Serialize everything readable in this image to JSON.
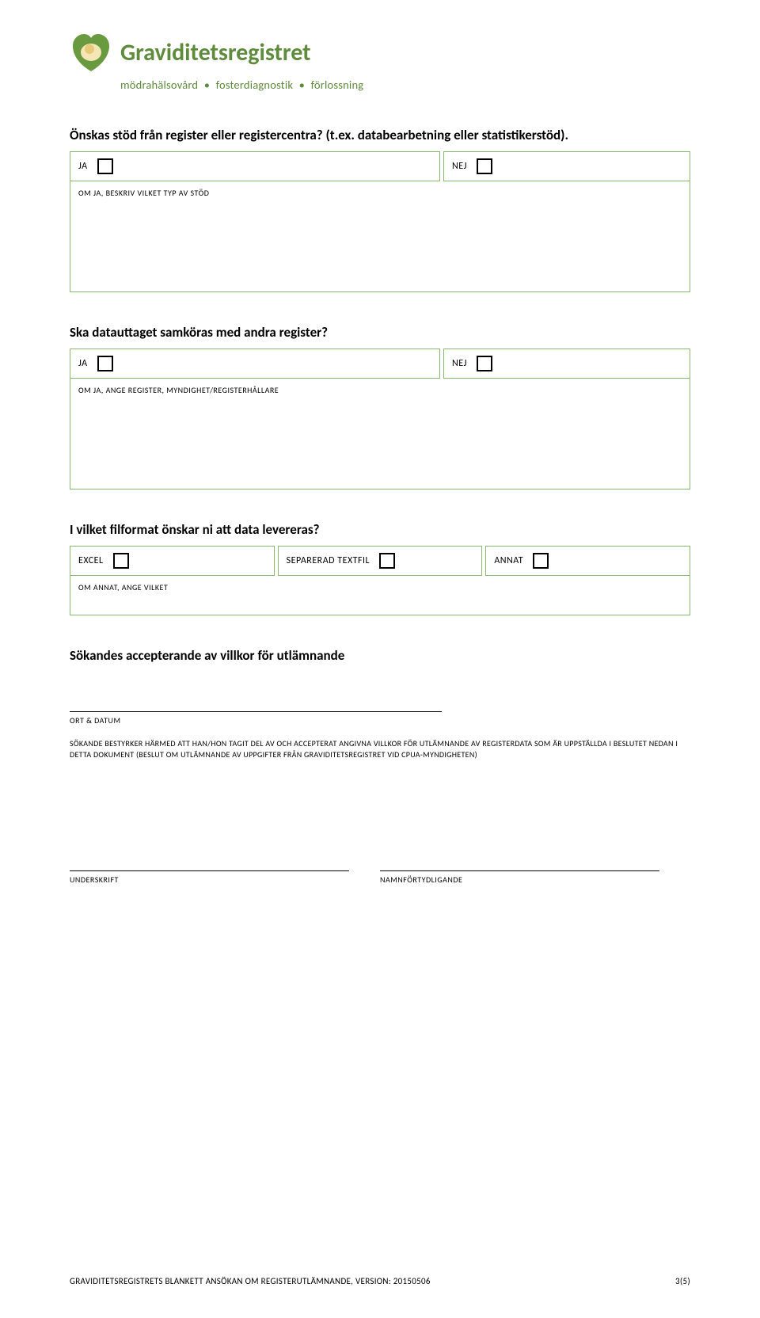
{
  "logo": {
    "title": "Graviditetsregistret",
    "tag1": "mödrahälsovård",
    "tag2": "fosterdiagnostik",
    "tag3": "förlossning"
  },
  "q1": {
    "heading": "Önskas stöd från register eller registercentra? (t.ex. databearbetning eller statistikerstöd).",
    "ja": "JA",
    "nej": "NEJ",
    "sub": "OM JA, BESKRIV VILKET TYP AV STÖD"
  },
  "q2": {
    "heading": "Ska datauttaget samköras med andra register?",
    "ja": "JA",
    "nej": "NEJ",
    "sub": "OM JA, ANGE REGISTER, MYNDIGHET/REGISTERHÅLLARE"
  },
  "q3": {
    "heading": "I vilket filformat önskar ni att data levereras?",
    "opt1": "EXCEL",
    "opt2": "SEPARERAD TEXTFIL",
    "opt3": "ANNAT",
    "sub": "OM ANNAT, ANGE VILKET"
  },
  "accept": {
    "heading": "Sökandes accepterande av villkor för utlämnande",
    "ort_datum": "ORT & DATUM",
    "disclaimer": "SÖKANDE BESTYRKER HÄRMED ATT HAN/HON TAGIT DEL AV OCH ACCEPTERAT ANGIVNA VILLKOR FÖR UTLÄMNANDE AV REGISTERDATA SOM ÄR UPPSTÄLLDA I BESLUTET NEDAN I DETTA DOKUMENT (BESLUT OM UTLÄMNANDE AV UPPGIFTER FRÅN GRAVIDITETSREGISTRET VID CPUA-MYNDIGHETEN)",
    "underskrift": "UNDERSKRIFT",
    "namn": "NAMNFÖRTYDLIGANDE"
  },
  "footer": {
    "left": "GRAVIDITETSREGISTRETS BLANKETT ANSÖKAN OM REGISTERUTLÄMNANDE, VERSION: 20150506",
    "right": "3(5)"
  }
}
